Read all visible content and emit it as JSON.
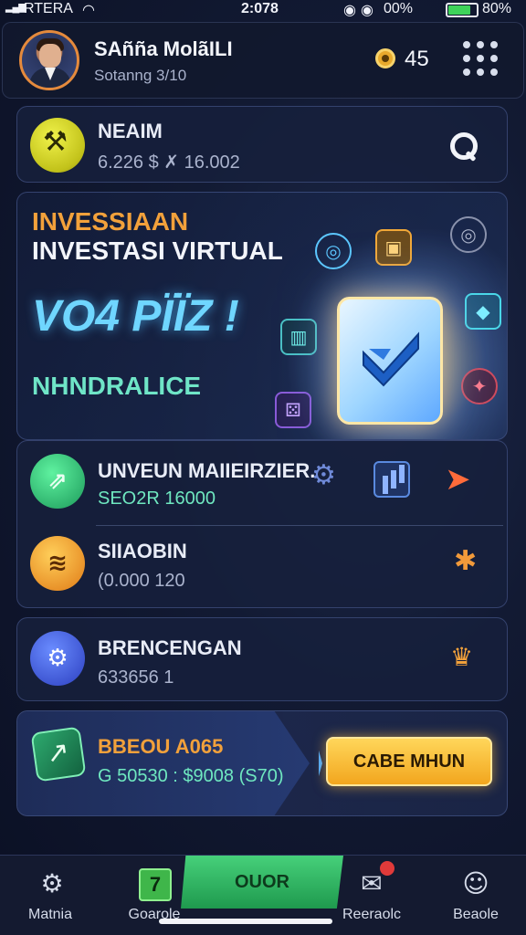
{
  "status_bar": {
    "carrier": "RTERA",
    "time": "2:078",
    "battery_pct": "00%",
    "battery_text": "80%",
    "battery_level": 0.8
  },
  "header": {
    "user_name": "SAñña MolãILI",
    "user_sub": "Sotanng 3/10",
    "coin_count": "45"
  },
  "balance": {
    "title": "NEAIM",
    "value": "6.226 $ ✗ 16.002"
  },
  "hero": {
    "kicker": "INVESSIAAN",
    "title": "INVESTASI VIRTUAL",
    "big": "VO4 PÏÏZ !",
    "sub": "NHNDRALICE"
  },
  "list": {
    "items": [
      {
        "title": "UNVEUN MAIIEIRZIER.",
        "sub": "SEO2R 16000",
        "icon": "growth-icon"
      },
      {
        "title": "SIIAOBIN",
        "sub": "(0.000 120",
        "icon": "stack-icon"
      }
    ]
  },
  "settings": {
    "title": "BRENCENGAN",
    "sub": "633656 1"
  },
  "promo": {
    "title": "BBEOU A065",
    "sub": "G 50530 : $9008 (S70)",
    "cta": "CABE MHUN"
  },
  "nav": {
    "home": "Matnia",
    "wallet": "Goarole",
    "active": "OUOR",
    "messages": "Reeraolc",
    "profile": "Beaole"
  },
  "colors": {
    "accent_orange": "#f2a13b",
    "accent_green": "#46d07a",
    "accent_cyan": "#6fd6ff",
    "bg_dark": "#121a33"
  }
}
